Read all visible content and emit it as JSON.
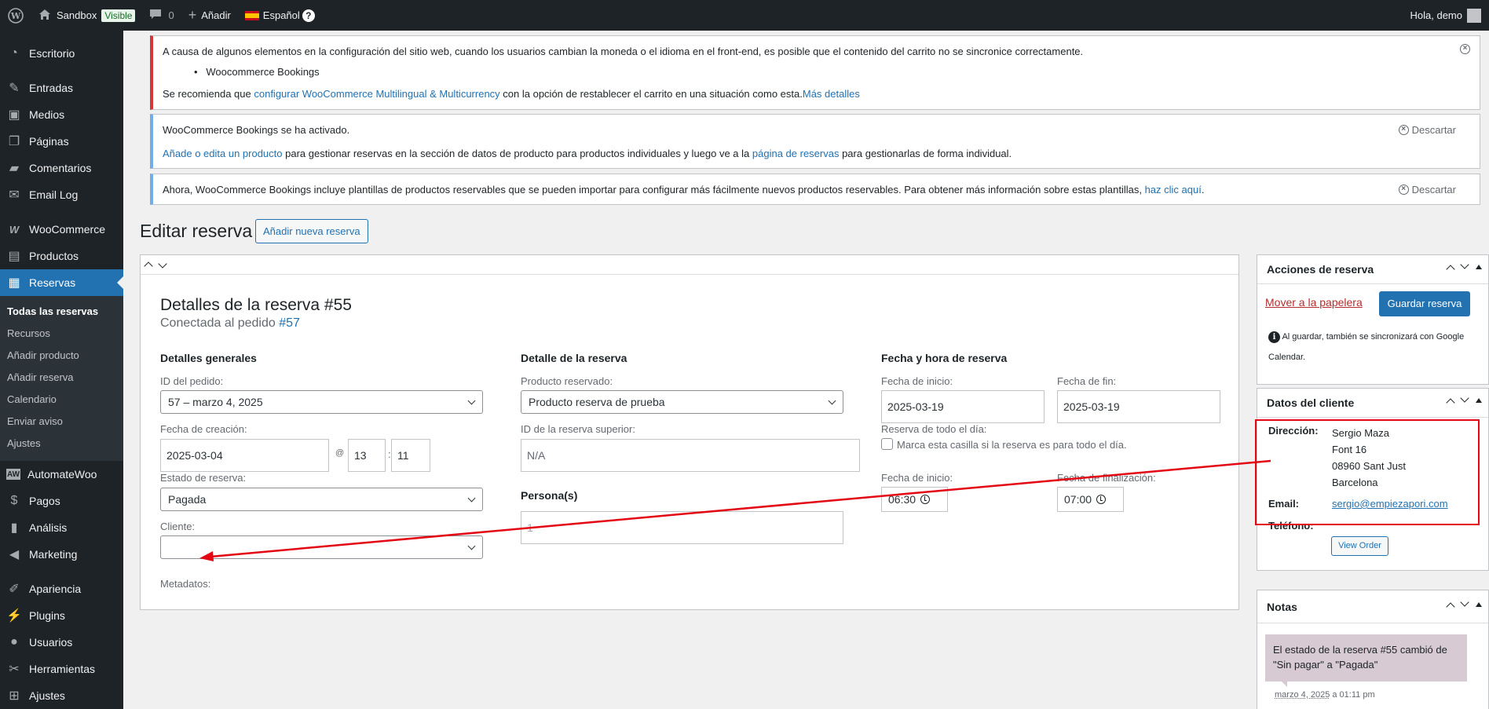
{
  "adminbar": {
    "site_name": "Sandbox",
    "visibility_badge": "Visible",
    "comments_count": "0",
    "add_new": "Añadir",
    "language": "Español",
    "greeting": "Hola, demo"
  },
  "sidebar": {
    "items": [
      {
        "label": "Escritorio",
        "icon": "dashboard-icon"
      },
      {
        "label": "Entradas",
        "icon": "pin-icon"
      },
      {
        "label": "Medios",
        "icon": "media-icon"
      },
      {
        "label": "Páginas",
        "icon": "pages-icon"
      },
      {
        "label": "Comentarios",
        "icon": "comment-icon"
      },
      {
        "label": "Email Log",
        "icon": "email-icon"
      },
      {
        "label": "WooCommerce",
        "icon": "woocommerce-icon"
      },
      {
        "label": "Productos",
        "icon": "products-icon"
      },
      {
        "label": "Reservas",
        "icon": "calendar-icon"
      },
      {
        "label": "AutomateWoo",
        "icon": "automatewoo-icon"
      },
      {
        "label": "Pagos",
        "icon": "payments-icon"
      },
      {
        "label": "Análisis",
        "icon": "analytics-icon"
      },
      {
        "label": "Marketing",
        "icon": "megaphone-icon"
      },
      {
        "label": "Apariencia",
        "icon": "brush-icon"
      },
      {
        "label": "Plugins",
        "icon": "plugin-icon"
      },
      {
        "label": "Usuarios",
        "icon": "user-icon"
      },
      {
        "label": "Herramientas",
        "icon": "wrench-icon"
      },
      {
        "label": "Ajustes",
        "icon": "settings-icon"
      }
    ],
    "submenu": [
      "Todas las reservas",
      "Recursos",
      "Añadir producto",
      "Añadir reserva",
      "Calendario",
      "Enviar aviso",
      "Ajustes"
    ]
  },
  "notices": {
    "n1": {
      "text": "A causa de algunos elementos en la configuración del sitio web, cuando los usuarios cambian la moneda o el idioma en el front-end, es posible que el contenido del carrito no se sincronice correctamente.",
      "bullet": "Woocommerce Bookings",
      "rec_pre": "Se recomienda que ",
      "rec_link": "configurar WooCommerce Multilingual & Multicurrency",
      "rec_mid": " con la opción de restablecer el carrito en una situación como esta.",
      "rec_more": "Más detalles"
    },
    "n2": {
      "title": "WooCommerce Bookings se ha activado.",
      "link1": "Añade o edita un producto",
      "mid": " para gestionar reservas en la sección de datos de producto para productos individuales y luego ve a la ",
      "link2": "página de reservas",
      "end": " para gestionarlas de forma individual.",
      "dismiss": "Descartar"
    },
    "n3": {
      "text": "Ahora, WooCommerce Bookings incluye plantillas de productos reservables que se pueden importar para configurar más fácilmente nuevos productos reservables. Para obtener más información sobre estas plantillas, ",
      "link": "haz clic aquí",
      "end": ".",
      "dismiss": "Descartar"
    }
  },
  "page": {
    "title": "Editar reserva",
    "add_new": "Añadir nueva reserva"
  },
  "booking": {
    "heading": "Detalles de la reserva #55",
    "sub_pre": "Conectada al pedido ",
    "sub_link": "#57",
    "general": {
      "title": "Detalles generales",
      "order_id_label": "ID del pedido:",
      "order_id_value": "57 – marzo 4, 2025",
      "created_label": "Fecha de creación:",
      "created_date": "2025-03-04",
      "at": "@",
      "hour": "13",
      "colon": ":",
      "minute": "11",
      "status_label": "Estado de reserva:",
      "status_value": "Pagada",
      "customer_label": "Cliente:",
      "customer_value": "",
      "meta_label": "Metadatos:"
    },
    "detail": {
      "title": "Detalle de la reserva",
      "product_label": "Producto reservado:",
      "product_value": "Producto reserva de prueba",
      "parent_label": "ID de la reserva superior:",
      "parent_placeholder": "N/A",
      "persons_label": "Persona(s)",
      "persons_value": "1"
    },
    "datetime": {
      "title": "Fecha y hora de reserva",
      "start_label": "Fecha de inicio:",
      "start_value": "2025-03-19",
      "end_label": "Fecha de fin:",
      "end_value": "2025-03-19",
      "allday_label": "Reserva de todo el día:",
      "allday_checkbox": "Marca esta casilla si la reserva es para todo el día.",
      "start_time_label": "Fecha de inicio:",
      "start_time": "06:30",
      "end_time_label": "Fecha de finalización:",
      "end_time": "07:00"
    }
  },
  "actions": {
    "title": "Acciones de reserva",
    "trash": "Mover a la papelera",
    "save": "Guardar reserva",
    "note": "Al guardar, también se sincronizará con Google Calendar."
  },
  "customer": {
    "title": "Datos del cliente",
    "address_label": "Dirección:",
    "address_lines": [
      "Sergio Maza",
      "Font 16",
      "08960 Sant Just",
      "Barcelona"
    ],
    "email_label": "Email:",
    "email": "sergio@empiezapori.com",
    "phone_label": "Teléfono:",
    "view_order": "View Order"
  },
  "notes": {
    "title": "Notas",
    "note_text": "El estado de la reserva #55 cambió de \"Sin pagar\" a \"Pagada\"",
    "note_date": "marzo 4, 2025",
    "note_time": " a 01:11 pm"
  },
  "colors": {
    "sidebar_bg": "#1d2327",
    "accent": "#2271b1",
    "error": "#d63638",
    "annotation": "#e30613",
    "note_bg": "#d7cad2"
  }
}
